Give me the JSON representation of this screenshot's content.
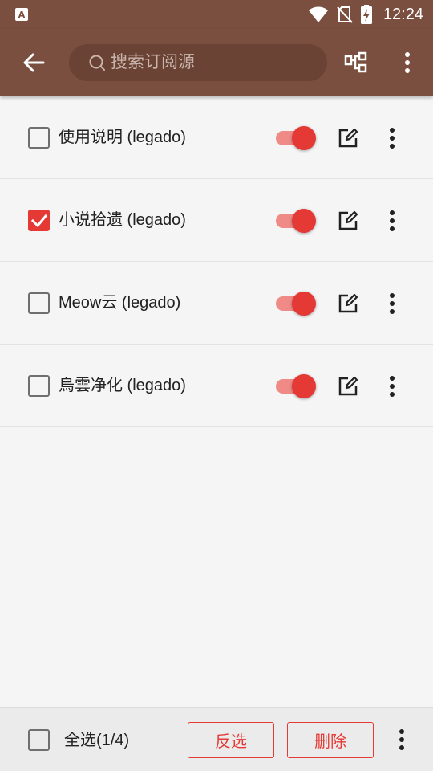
{
  "status_bar": {
    "time": "12:24"
  },
  "toolbar": {
    "search_placeholder": "搜索订阅源"
  },
  "items": [
    {
      "name": "使用说明 (legado)",
      "checked": false,
      "enabled": true
    },
    {
      "name": "小说拾遗 (legado)",
      "checked": true,
      "enabled": true
    },
    {
      "name": "Meow云 (legado)",
      "checked": false,
      "enabled": true
    },
    {
      "name": "烏雲净化 (legado)",
      "checked": false,
      "enabled": true
    }
  ],
  "bottom_bar": {
    "select_all_label": "全选(1/4)",
    "invert_label": "反选",
    "delete_label": "删除"
  },
  "colors": {
    "primary": "#7a4f3f",
    "accent": "#e53935"
  }
}
